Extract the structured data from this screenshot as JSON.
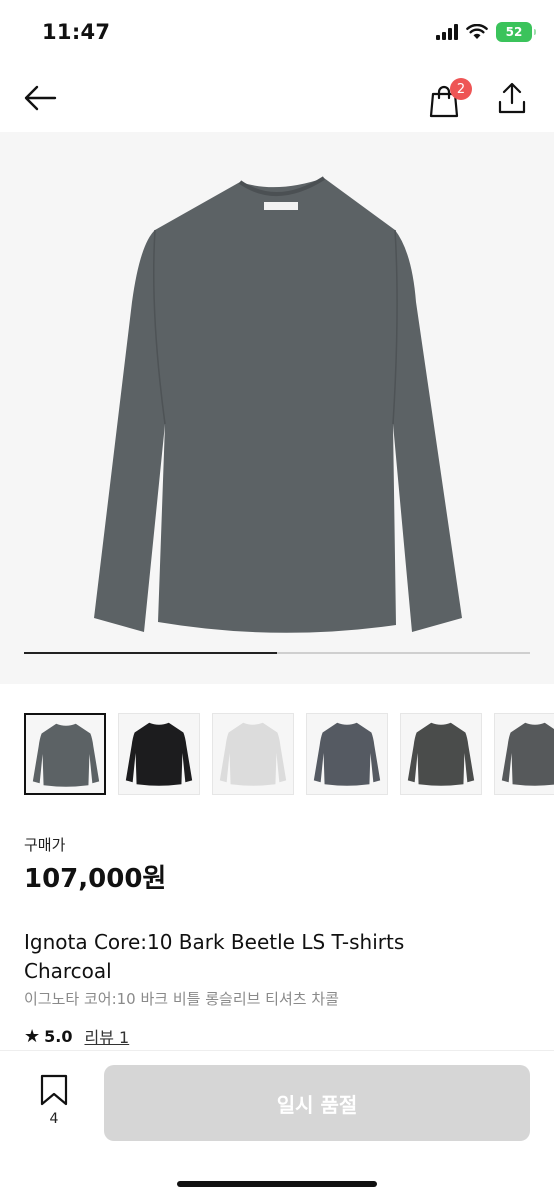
{
  "status_bar": {
    "time": "11:47",
    "battery": "52"
  },
  "nav": {
    "cart_count": "2"
  },
  "gallery": {
    "progress": 0.5,
    "selected_index": 0
  },
  "thumbnails": [
    {
      "color": "#5c6265"
    },
    {
      "color": "#1c1c1e"
    },
    {
      "color": "#dcdcdc"
    },
    {
      "color": "#555a62"
    },
    {
      "color": "#4a4c4b"
    },
    {
      "color": "#56595b"
    }
  ],
  "product": {
    "price_label": "구매가",
    "price": "107,000원",
    "title_en": "Ignota Core:10 Bark Beetle LS T-shirts Charcoal",
    "title_ko": "이그노타 코어:10 바크 비틀 롱슬리브 티셔츠 차콜",
    "rating": "5.0",
    "review_label": "리뷰 1"
  },
  "bottom": {
    "bookmark_count": "4",
    "soldout_label": "일시 품절"
  },
  "colors": {
    "garment": "#5c6265",
    "soldout": "#d6d6d6",
    "badge": "#ee5555"
  }
}
